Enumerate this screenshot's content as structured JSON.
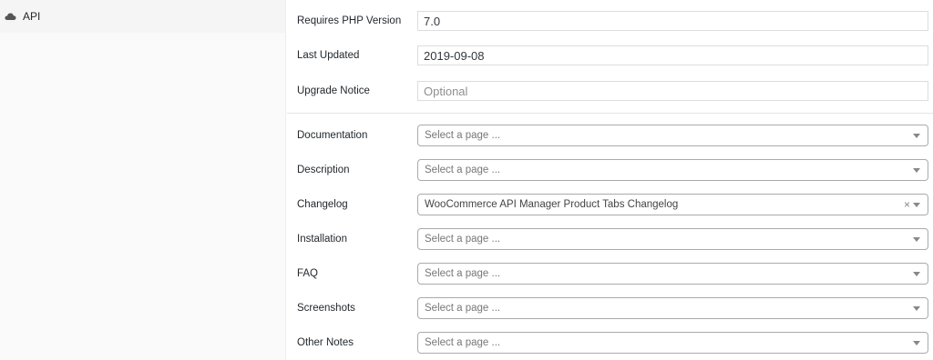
{
  "sidebar": {
    "tab": {
      "label": "API",
      "icon": "cloud-icon"
    }
  },
  "fields": {
    "php_version": {
      "label": "Requires PHP Version",
      "value": "7.0"
    },
    "last_updated": {
      "label": "Last Updated",
      "value": "2019-09-08"
    },
    "upgrade_notice": {
      "label": "Upgrade Notice",
      "value": "",
      "placeholder": "Optional"
    }
  },
  "pages": {
    "documentation": {
      "label": "Documentation",
      "value": "Select a page ..."
    },
    "description": {
      "label": "Description",
      "value": "Select a page ..."
    },
    "changelog": {
      "label": "Changelog",
      "value": "WooCommerce API Manager Product Tabs Changelog",
      "clear": "×"
    },
    "installation": {
      "label": "Installation",
      "value": "Select a page ..."
    },
    "faq": {
      "label": "FAQ",
      "value": "Select a page ..."
    },
    "screenshots": {
      "label": "Screenshots",
      "value": "Select a page ..."
    },
    "other_notes": {
      "label": "Other Notes",
      "value": "Select a page ..."
    }
  }
}
